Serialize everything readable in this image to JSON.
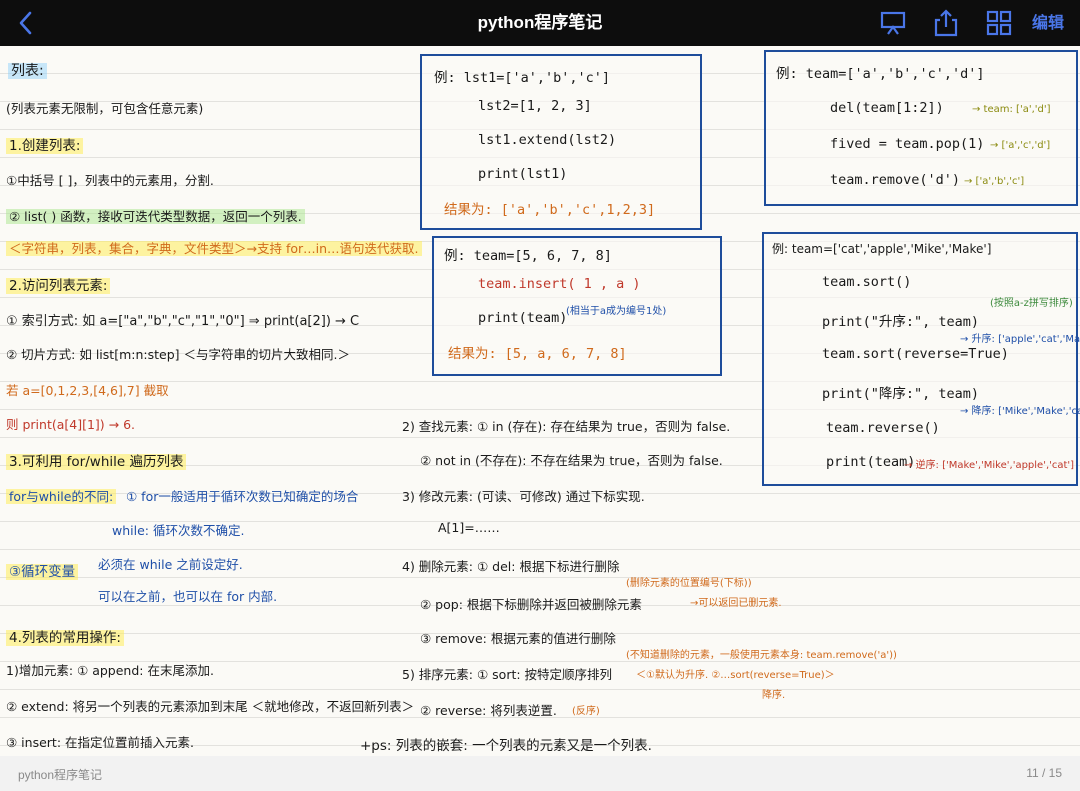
{
  "app": {
    "title": "python程序笔记",
    "edit_label": "编辑",
    "accent": "#4a76e8",
    "icons": [
      "back-chevron-icon",
      "marker-icon",
      "share-icon",
      "grid-icon"
    ]
  },
  "footer": {
    "doc_name": "python程序笔记",
    "page_indicator": "11 / 15"
  },
  "note": {
    "left": {
      "heading": "列表:",
      "intro": "(列表元素无限制，可包含任意元素)",
      "s1_title": "1.创建列表:",
      "s1_a": "①中括号 [ ]，列表中的元素用，分割.",
      "s1_b": "② list( ) 函数，接收可迭代类型数据，返回一个列表.",
      "s1_c": "＜字符串，列表，集合，字典，文件类型＞→支持 for…in…语句迭代获取.",
      "s2_title": "2.访问列表元素:",
      "s2_a": "① 索引方式: 如 a=[\"a\",\"b\",\"c\",\"1\",\"0\"] ⇒ print(a[2]) → C",
      "s2_b": "② 切片方式: 如 list[m:n:step] ＜与字符串的切片大致相同.＞",
      "s2_c": "若 a=[0,1,2,3,[4,6],7] 截取",
      "s2_d": "则 print(a[4][1]) → 6.",
      "s3_title": "3.可利用 for/while 遍历列表",
      "s3_diff": "for与while的不同:",
      "s3_for": "① for一般适用于循环次数已知确定的场合",
      "s3_while": "while: 循环次数不确定.",
      "s3_loopvar": "③循环变量",
      "s3_lv1": "必须在 while 之前设定好.",
      "s3_lv2": "可以在之前，也可以在 for 内部.",
      "s4_title": "4.列表的常用操作:",
      "s4_add": "1)增加元素: ① append: 在末尾添加.",
      "s4_extend": "② extend: 将另一个列表的元素添加到末尾 ＜就地修改，不返回新列表＞",
      "s4_insert": "③ insert: 在指定位置前插入元素."
    },
    "middle": {
      "find_title": "2) 查找元素: ① in (存在): 存在结果为 true，否则为 false.",
      "find_not": "② not in (不存在): 不存在结果为 true，否则为 false.",
      "modify_title": "3) 修改元素: (可读、可修改) 通过下标实现.",
      "modify_ex": "A[1]=……",
      "del_title": "4) 删除元素: ① del: 根据下标进行删除",
      "del_note": "(删除元素的位置编号(下标))",
      "pop": "② pop: 根据下标删除并返回被删除元素",
      "pop_note": "→可以返回已删元素.",
      "remove": "③ remove: 根据元素的值进行删除",
      "remove_note": "(不知道删除的元素，一般使用元素本身: team.remove('a'))",
      "sort_title": "5) 排序元素: ① sort: 按特定顺序排列",
      "sort_note": "＜①默认为升序. ②…sort(reverse=True)＞",
      "sort_desc": "降序.",
      "reverse": "② reverse: 将列表逆置.",
      "reverse_note": "(反序)",
      "nest": "+ps: 列表的嵌套: 一个列表的元素又是一个列表."
    },
    "box1": {
      "l1": "例: lst1=['a','b','c']",
      "l2": "lst2=[1, 2, 3]",
      "l3": "lst1.extend(lst2)",
      "l4": "print(lst1)",
      "l5": "结果为: ['a','b','c',1,2,3]"
    },
    "box2": {
      "l1": "例: team=[5, 6, 7, 8]",
      "l2": "team.insert( 1 , a )",
      "l3": "print(team)",
      "l3_note": "(相当于a成为编号1处)",
      "l4": "结果为: [5, a, 6, 7, 8]"
    },
    "box3": {
      "l1": "例: team=['a','b','c','d']",
      "l2": "del(team[1:2])",
      "l2_r": "→ team: ['a','d']",
      "l3": "fived = team.pop(1)",
      "l3_r": "→ ['a','c','d']",
      "l4": "team.remove('d')",
      "l4_r": "→ ['a','b','c']"
    },
    "box4": {
      "l1": "例: team=['cat','apple','Mike','Make']",
      "l2": "team.sort()",
      "l3": "print(\"升序:\", team)",
      "l3_r": "→ 升序: ['apple','cat','Make','Mike']",
      "l3_note": "(按照a-z拼写排序)",
      "l4": "team.sort(reverse=True)",
      "l5": "print(\"降序:\", team)",
      "l5_r": "→ 降序: ['Mike','Make','cat','apple']",
      "l6": "team.reverse()",
      "l7": "print(team)",
      "l7_r": "→ 逆序: ['Make','Mike','apple','cat']"
    }
  }
}
